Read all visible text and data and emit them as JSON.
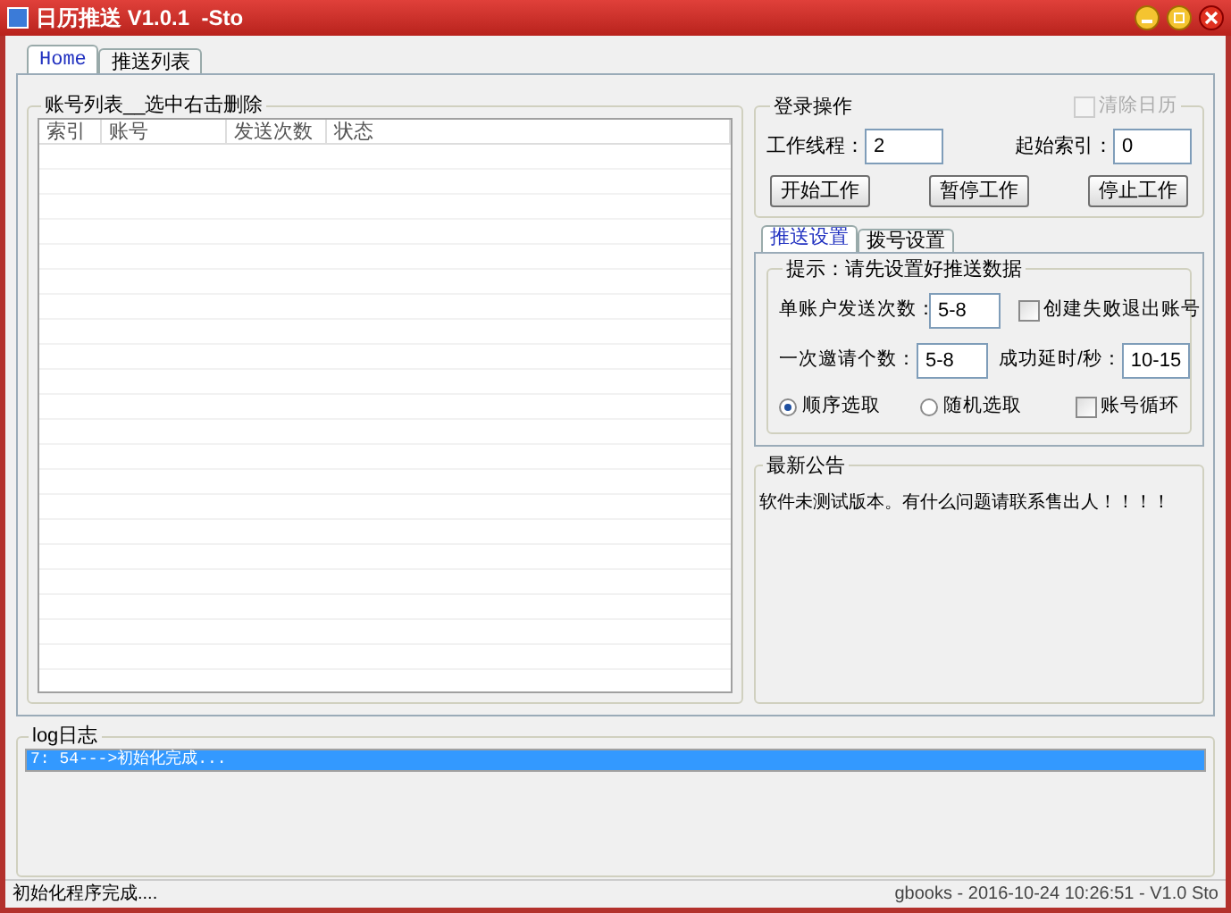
{
  "window": {
    "title": "日历推送 V1.0.1  -Sto"
  },
  "tabs": [
    {
      "label": "Home",
      "selected": true
    },
    {
      "label": "推送列表",
      "selected": false
    }
  ],
  "account_list": {
    "title": "账号列表__选中右击删除",
    "columns": [
      "索引",
      "账号",
      "发送次数",
      "状态"
    ]
  },
  "login": {
    "title": "登录操作",
    "clear_calendar": {
      "label": "清除日历",
      "checked": false,
      "disabled": true
    },
    "fields": [
      {
        "label": "工作线程：",
        "value": "2"
      },
      {
        "label": "起始索引：",
        "value": "0"
      }
    ],
    "buttons": [
      "开始工作",
      "暂停工作",
      "停止工作"
    ]
  },
  "settings_tabs": [
    {
      "label": "推送设置",
      "selected": true
    },
    {
      "label": "拨号设置",
      "selected": false
    }
  ],
  "push_settings": {
    "title": "提示：请先设置好推送数据",
    "fields": [
      {
        "label": "单账户发送次数：",
        "value": "5-8"
      },
      {
        "label": "一次邀请个数：",
        "value": "5-8"
      },
      {
        "label": "成功延时/秒：",
        "value": "10-15"
      }
    ],
    "exit_on_fail": {
      "label": "创建失败退出账号",
      "checked": false
    },
    "order": [
      {
        "label": "顺序选取",
        "selected": true
      },
      {
        "label": "随机选取",
        "selected": false
      }
    ],
    "loop": {
      "label": "账号循环",
      "checked": false
    }
  },
  "notice": {
    "title": "最新公告",
    "text": "软件未测试版本。有什么问题请联系售出人！！！！"
  },
  "log": {
    "title": "log日志",
    "lines": [
      {
        "text": "7: 54--->初始化完成...",
        "selected": true
      }
    ]
  },
  "status_bar": {
    "left": "初始化程序完成....",
    "right": "gbooks - 2016-10-24 10:26:51 - V1.0 Sto"
  }
}
